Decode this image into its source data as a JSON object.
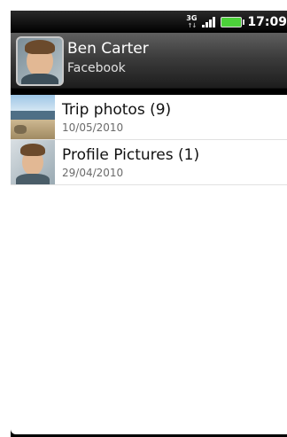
{
  "status": {
    "network": "3G",
    "time": "17:09",
    "icons": [
      "network-3g-icon",
      "signal-icon",
      "battery-icon"
    ]
  },
  "header": {
    "name": "Ben Carter",
    "source": "Facebook"
  },
  "albums": [
    {
      "title": "Trip photos",
      "count": "(9)",
      "date": "10/05/2010",
      "thumb": "beach-photo"
    },
    {
      "title": "Profile Pictures",
      "count": "(1)",
      "date": "29/04/2010",
      "thumb": "profile-photo"
    }
  ],
  "colors": {
    "battery": "#4cd13a",
    "header_top": "#5f5f5f",
    "header_bottom": "#1d1d1d",
    "date_text": "#6b6b6b"
  }
}
